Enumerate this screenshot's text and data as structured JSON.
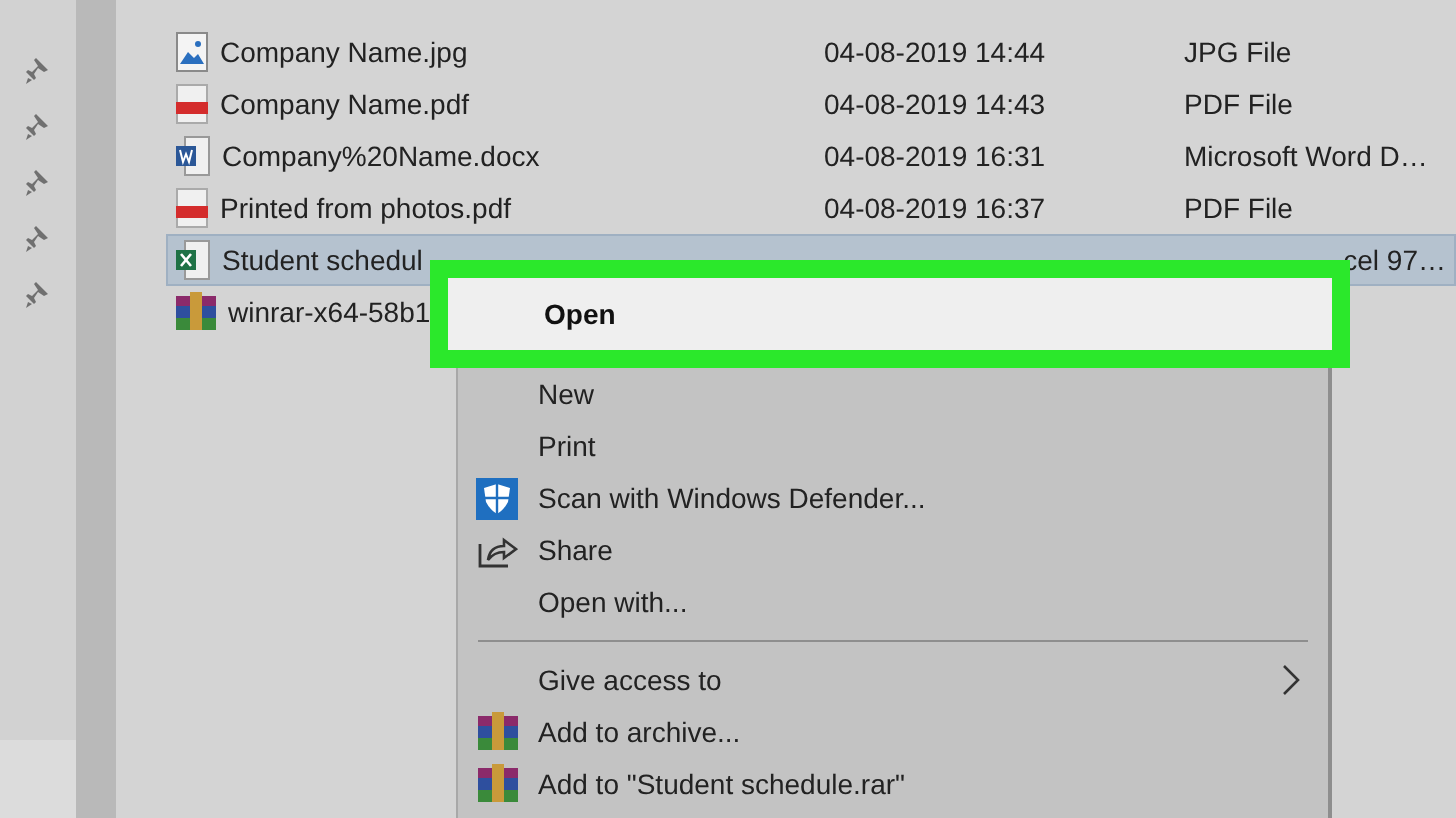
{
  "files": [
    {
      "kind": "image",
      "name": "Company Name.jpg",
      "date": "04-08-2019 14:44",
      "type": "JPG File",
      "selected": false
    },
    {
      "kind": "pdf",
      "name": "Company Name.pdf",
      "date": "04-08-2019 14:43",
      "type": "PDF File",
      "selected": false
    },
    {
      "kind": "word",
      "name": "Company%20Name.docx",
      "date": "04-08-2019 16:31",
      "type": "Microsoft Word D…",
      "selected": false
    },
    {
      "kind": "pdf",
      "name": "Printed from photos.pdf",
      "date": "04-08-2019 16:37",
      "type": "PDF File",
      "selected": false
    },
    {
      "kind": "excel",
      "name": "Student schedul",
      "type": "cel 97…",
      "selected": true,
      "type_cut": true
    },
    {
      "kind": "archive",
      "name": "winrar-x64-58b1",
      "selected": false
    }
  ],
  "context_menu": {
    "items": [
      {
        "kind": "plain",
        "label": "Open",
        "selected": true
      },
      {
        "kind": "plain",
        "label": "New",
        "selected": false
      },
      {
        "kind": "plain",
        "label": "Print",
        "selected": false
      },
      {
        "kind": "defender",
        "label": "Scan with Windows Defender...",
        "selected": false
      },
      {
        "kind": "share",
        "label": "Share",
        "selected": false
      },
      {
        "kind": "plain",
        "label": "Open with...",
        "selected": false
      },
      {
        "kind": "separator"
      },
      {
        "kind": "plain",
        "label": "Give access to",
        "submenu": true,
        "selected": false
      },
      {
        "kind": "archive",
        "label": "Add to archive...",
        "selected": false
      },
      {
        "kind": "archive",
        "label": "Add to \"Student schedule.rar\"",
        "selected": false
      }
    ]
  }
}
